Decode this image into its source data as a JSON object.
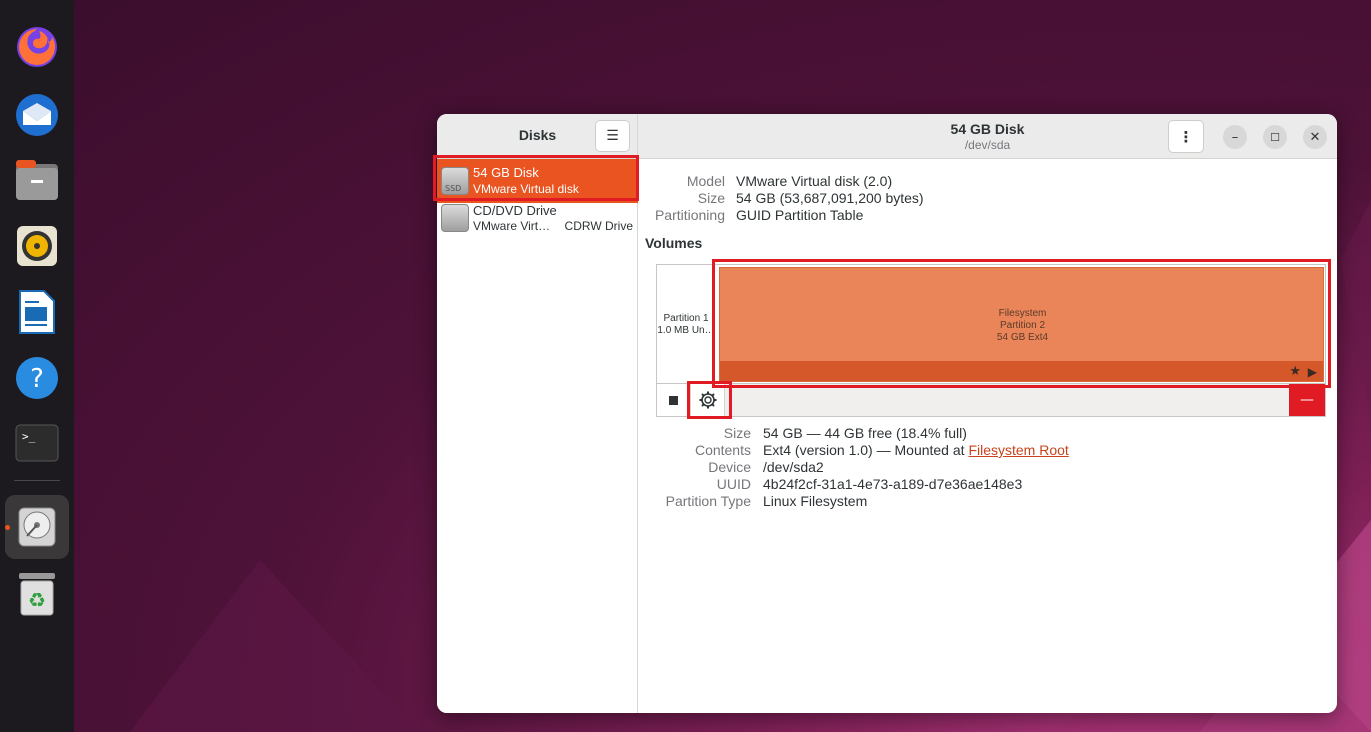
{
  "dock": {
    "apps": [
      "firefox-icon",
      "thunderbird-icon",
      "files-icon",
      "rhythmbox-icon",
      "writer-icon",
      "help-icon",
      "terminal-icon",
      "disks-icon",
      "trash-icon"
    ]
  },
  "sidebar": {
    "title": "Disks",
    "disks": [
      {
        "name": "54 GB Disk",
        "sub": "VMware Virtual disk",
        "icon_label": "SSD",
        "extra": ""
      },
      {
        "name": "CD/DVD Drive",
        "sub": "VMware Virt…",
        "icon_label": "",
        "extra": "CDRW Drive"
      }
    ]
  },
  "header": {
    "title": "54 GB Disk",
    "subtitle": "/dev/sda"
  },
  "disk_info": {
    "model_label": "Model",
    "model_value": "VMware Virtual disk (2.0)",
    "size_label": "Size",
    "size_value": "54 GB (53,687,091,200 bytes)",
    "partitioning_label": "Partitioning",
    "partitioning_value": "GUID Partition Table"
  },
  "volumes": {
    "title": "Volumes",
    "partition1": {
      "line1": "Partition 1",
      "line2": "1.0 MB Un…"
    },
    "partition2": {
      "line1": "Filesystem",
      "line2": "Partition 2",
      "line3": "54 GB Ext4"
    }
  },
  "volume_info": {
    "size_label": "Size",
    "size_value": "54 GB — 44 GB free (18.4% full)",
    "contents_label": "Contents",
    "contents_value": "Ext4 (version 1.0) — Mounted at ",
    "contents_link": "Filesystem Root",
    "device_label": "Device",
    "device_value": "/dev/sda2",
    "uuid_label": "UUID",
    "uuid_value": "4b24f2cf-31a1-4e73-a189-d7e36ae148e3",
    "ptype_label": "Partition Type",
    "ptype_value": "Linux Filesystem"
  },
  "colors": {
    "accent": "#e95420",
    "partition_fill": "#ea8559",
    "highlight": "#e01b24",
    "destructive": "#e01b24"
  }
}
